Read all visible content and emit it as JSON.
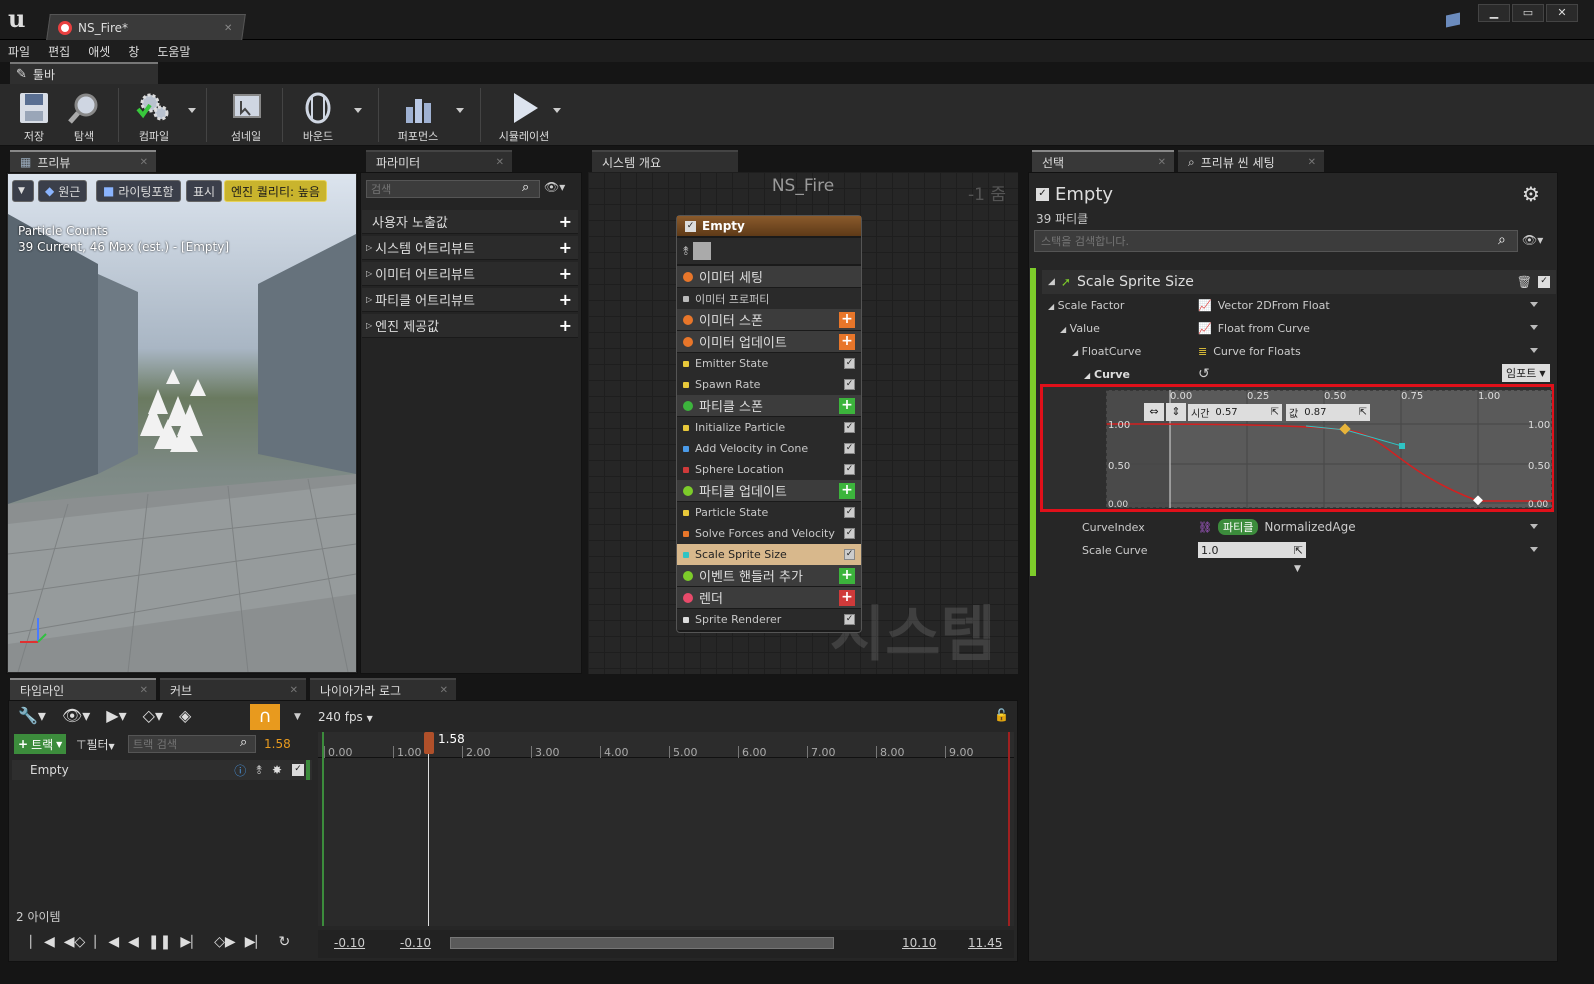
{
  "window": {
    "tab_title": "NS_Fire*",
    "min": "▁",
    "max": "▭",
    "close": "✕"
  },
  "menu": [
    "파일",
    "편집",
    "애셋",
    "창",
    "도움말"
  ],
  "toolbar": {
    "tab_label": "툴바",
    "items": [
      "저장",
      "탐색",
      "컴파일",
      "섬네일",
      "바운드",
      "퍼포먼스",
      "시뮬레이션"
    ]
  },
  "preview": {
    "tab_label": "프리뷰",
    "buttons": {
      "perspective": "원근",
      "lighting": "라이팅포함",
      "show": "표시",
      "quality": "엔진 퀄리티: 높음"
    },
    "stats_title": "Particle Counts",
    "stats_line": "39 Current, 46 Max (est.) - [Empty]"
  },
  "parameters": {
    "tab_label": "파라미터",
    "search_placeholder": "검색",
    "rows": [
      "사용자 노출값",
      "시스템 어트리뷰트",
      "이미터 어트리뷰트",
      "파티클 어트리뷰트",
      "엔진 제공값"
    ]
  },
  "system_overview": {
    "tab_label": "시스템 개요",
    "title": "NS_Fire",
    "zoom": "-1 줌",
    "watermark": "시스템",
    "node": {
      "title": "Empty",
      "rows": [
        {
          "label": "이미터 세팅",
          "kind": "head"
        },
        {
          "label": "이미터 프로퍼티",
          "kind": "sub"
        },
        {
          "label": "이미터 스폰",
          "kind": "head",
          "plus": "orange"
        },
        {
          "label": "이미터 업데이트",
          "kind": "head",
          "plus": "orange"
        },
        {
          "label": "Emitter State",
          "kind": "sub"
        },
        {
          "label": "Spawn Rate",
          "kind": "sub"
        },
        {
          "label": "파티클 스폰",
          "kind": "head",
          "plus": "green"
        },
        {
          "label": "Initialize Particle",
          "kind": "sub"
        },
        {
          "label": "Add Velocity in Cone",
          "kind": "sub"
        },
        {
          "label": "Sphere Location",
          "kind": "sub"
        },
        {
          "label": "파티클 업데이트",
          "kind": "head",
          "plus": "green"
        },
        {
          "label": "Particle State",
          "kind": "sub"
        },
        {
          "label": "Solve Forces and Velocity",
          "kind": "sub"
        },
        {
          "label": "Scale Sprite Size",
          "kind": "sub",
          "selected": true
        },
        {
          "label": "이벤트 핸들러 추가",
          "kind": "head",
          "plus": "green"
        },
        {
          "label": "렌더",
          "kind": "head",
          "plus": "red"
        },
        {
          "label": "Sprite Renderer",
          "kind": "sub"
        }
      ]
    }
  },
  "selection": {
    "tab_label": "선택",
    "preview_scene_tab": "프리뷰 씬 세팅",
    "title": "Empty",
    "subtitle": "39 파티클",
    "search_placeholder": "스택을 검색합니다.",
    "module_title": "Scale Sprite Size",
    "props": [
      {
        "label": "Scale Factor",
        "value": "Vector 2DFrom Float"
      },
      {
        "label": "Value",
        "value": "Float from Curve"
      },
      {
        "label": "FloatCurve",
        "value": "Curve for Floats"
      },
      {
        "label": "Curve",
        "value": ""
      }
    ],
    "import_btn": "임포트",
    "curve": {
      "time_label": "시간",
      "time_value": "0.57",
      "value_label": "값",
      "value_value": "0.87",
      "x_ticks": [
        "0.00",
        "0.25",
        "0.50",
        "0.75",
        "1.00"
      ],
      "y_ticks_left": [
        "1.00",
        "0.50",
        "0.00"
      ],
      "y_ticks_right": [
        "1.00",
        "0.50",
        "0.00"
      ]
    },
    "curve_index": {
      "label": "CurveIndex",
      "badge": "파티클",
      "value": "NormalizedAge"
    },
    "scale_curve": {
      "label": "Scale Curve",
      "value": "1.0"
    }
  },
  "timeline": {
    "tabs": [
      "타임라인",
      "커브",
      "나이아가라 로그"
    ],
    "fps": "240 fps",
    "track_btn": "트랙",
    "filter_btn": "필터",
    "search_placeholder": "트랙 검색",
    "current_time": "1.58",
    "playhead": "1.58",
    "ticks": [
      "0.00",
      "1.00",
      "2.00",
      "3.00",
      "4.00",
      "5.00",
      "6.00",
      "7.00",
      "8.00",
      "9.00"
    ],
    "track_name": "Empty",
    "item_count": "2 아이템",
    "range_start1": "-0.10",
    "range_start2": "-0.10",
    "range_end1": "10.10",
    "range_end2": "11.45"
  }
}
